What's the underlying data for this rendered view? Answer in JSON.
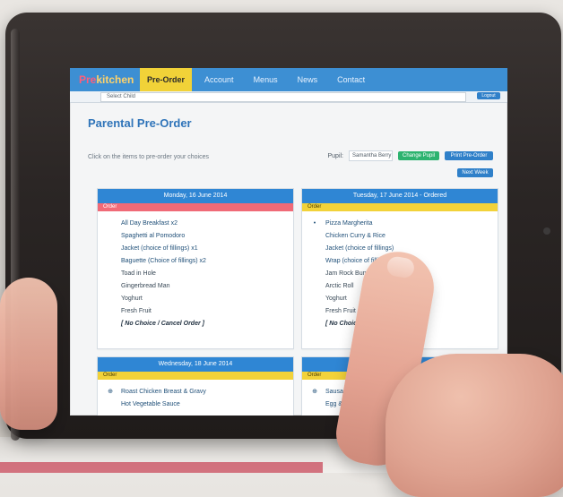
{
  "app": {
    "brand_prefix": "Pre",
    "brand_main": "kitchen",
    "nav": [
      "Pre-Order",
      "Account",
      "Menus",
      "News",
      "Contact"
    ],
    "school_select": "Select Child",
    "subbar_button": "Logout"
  },
  "page": {
    "title": "Parental Pre-Order",
    "description": "Click on the items to pre-order your choices",
    "pupil_label": "Pupil:",
    "pupil_value": "Samantha Berry",
    "buttons": {
      "change_pupil": "Change Pupil",
      "print": "Print Pre-Order",
      "extra": "Next Week"
    }
  },
  "days": [
    {
      "header": "Monday, 16 June 2014",
      "strip": "Order",
      "strip_color": "pink",
      "items": [
        "All Day Breakfast x2",
        "Spaghetti al Pomodoro",
        "Jacket (choice of fillings) x1",
        "Baguette (Choice of fillings) x2",
        "Toad in Hole",
        "Gingerbread Man",
        "Yoghurt",
        "Fresh Fruit",
        "[ No Choice / Cancel Order ]"
      ]
    },
    {
      "header": "Tuesday, 17 June 2014 - Ordered",
      "strip": "Order",
      "strip_color": "yellow",
      "items": [
        "Pizza Margherita",
        "Chicken Curry & Rice",
        "Jacket (choice of fillings)",
        "Wrap (choice of fillings)",
        "Jam Rock Bun",
        "Arctic Roll",
        "Yoghurt",
        "Fresh Fruit",
        "[ No Choice / Cancel"
      ]
    },
    {
      "header": "Wednesday, 18 June 2014",
      "strip": "Order",
      "strip_color": "yellow",
      "items": [
        "Roast Chicken Breast & Gravy",
        "Hot Vegetable Sauce"
      ]
    },
    {
      "header": "Thursday",
      "strip": "Order",
      "strip_color": "yellow",
      "items": [
        "Sausage Platter",
        "Egg & Cheese Salad & Roll"
      ]
    }
  ]
}
